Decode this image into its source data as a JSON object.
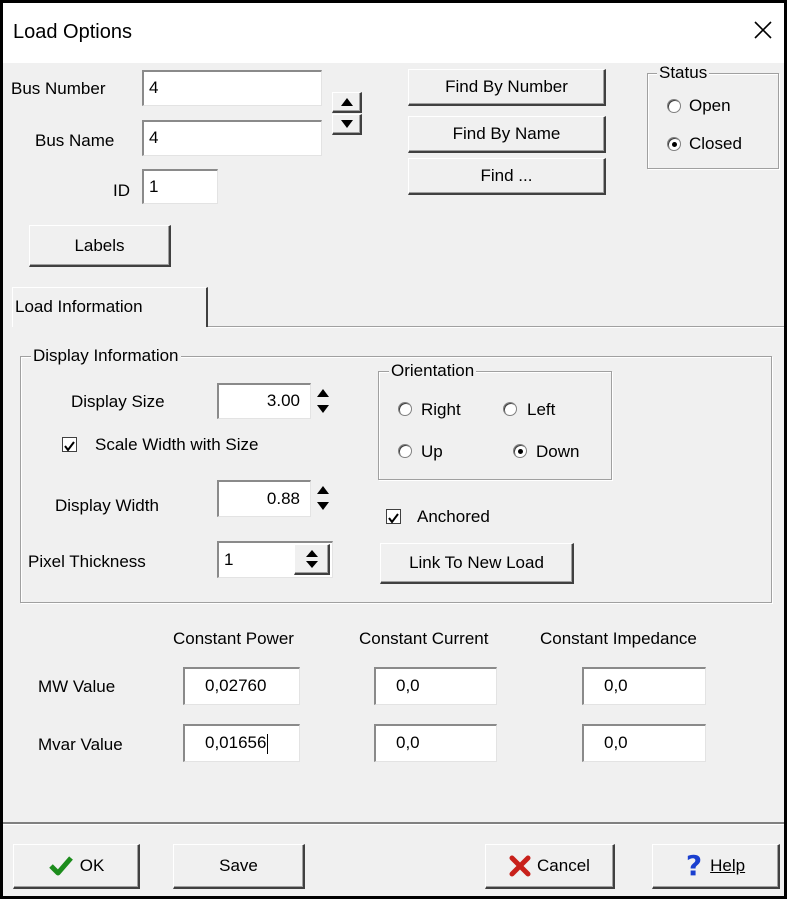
{
  "window": {
    "title": "Load Options"
  },
  "bus": {
    "number_label": "Bus Number",
    "number_value": "4",
    "name_label": "Bus Name",
    "name_value": "4",
    "id_label": "ID",
    "id_value": "1"
  },
  "find": {
    "by_number": "Find By Number",
    "by_name": "Find By Name",
    "find": "Find ..."
  },
  "status": {
    "title": "Status",
    "open": "Open",
    "closed": "Closed",
    "selected": "Closed"
  },
  "labels_button": "Labels",
  "tab": {
    "label": "Load Information"
  },
  "display": {
    "group_title": "Display Information",
    "size_label": "Display Size",
    "size_value": "3.00",
    "scale_label": "Scale Width with Size",
    "scale_checked": true,
    "width_label": "Display Width",
    "width_value": "0.88",
    "pixel_label": "Pixel Thickness",
    "pixel_value": "1"
  },
  "orientation": {
    "title": "Orientation",
    "right": "Right",
    "left": "Left",
    "up": "Up",
    "down": "Down",
    "selected": "Down"
  },
  "anchored": {
    "label": "Anchored",
    "checked": true
  },
  "link_button": "Link To New Load",
  "values": {
    "headers": {
      "power": "Constant Power",
      "current": "Constant Current",
      "impedance": "Constant Impedance"
    },
    "mw": {
      "label": "MW Value",
      "power": "0,02760",
      "current": "0,0",
      "impedance": "0,0"
    },
    "mvar": {
      "label": "Mvar Value",
      "power": "0,01656",
      "current": "0,0",
      "impedance": "0,0"
    }
  },
  "footer": {
    "ok": "OK",
    "save": "Save",
    "cancel": "Cancel",
    "help": "Help"
  }
}
